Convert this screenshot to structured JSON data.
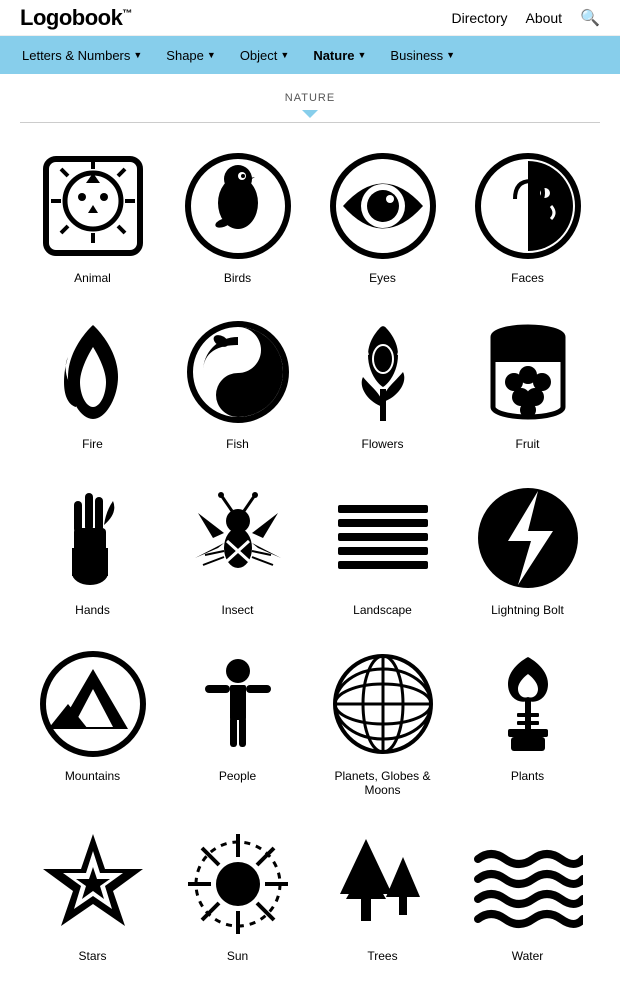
{
  "header": {
    "logo": "Logobook",
    "tm": "™",
    "nav": {
      "directory": "Directory",
      "about": "About",
      "search_icon": "🔍"
    }
  },
  "top_nav": {
    "items": [
      {
        "label": "Letters & Numbers",
        "arrow": "▼",
        "active": false
      },
      {
        "label": "Shape",
        "arrow": "▼",
        "active": false
      },
      {
        "label": "Object",
        "arrow": "▼",
        "active": false
      },
      {
        "label": "Nature",
        "arrow": "▼",
        "active": true
      },
      {
        "label": "Business",
        "arrow": "▼",
        "active": false
      }
    ]
  },
  "nature_label": "NATURE",
  "categories": [
    {
      "label": "Animal"
    },
    {
      "label": "Birds"
    },
    {
      "label": "Eyes"
    },
    {
      "label": "Faces"
    },
    {
      "label": "Fire"
    },
    {
      "label": "Fish"
    },
    {
      "label": "Flowers"
    },
    {
      "label": "Fruit"
    },
    {
      "label": "Hands"
    },
    {
      "label": "Insect"
    },
    {
      "label": "Landscape"
    },
    {
      "label": "Lightning Bolt"
    },
    {
      "label": "Mountains"
    },
    {
      "label": "People"
    },
    {
      "label": "Planets, Globes & Moons"
    },
    {
      "label": "Plants"
    },
    {
      "label": "Stars"
    },
    {
      "label": "Sun"
    },
    {
      "label": "Trees"
    },
    {
      "label": "Water"
    }
  ]
}
